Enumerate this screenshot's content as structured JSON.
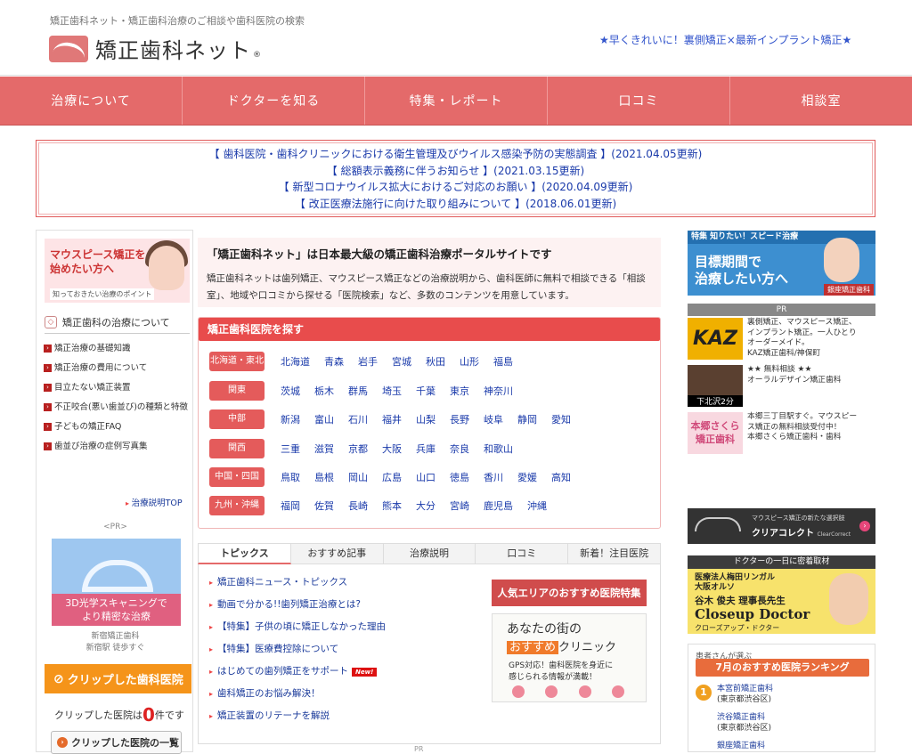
{
  "header": {
    "tagline": "矯正歯科ネット・矯正歯科治療のご相談や歯科医院の検索",
    "logo_text": "矯正歯科ネット",
    "logo_mark": "®",
    "promo": "★早くきれいに！裏側矯正×最新インプラント矯正★"
  },
  "nav": [
    "治療について",
    "ドクターを知る",
    "特集・レポート",
    "口コミ",
    "相談室"
  ],
  "notices": [
    "【 歯科医院・歯科クリニックにおける衛生管理及びウイルス感染予防の実態調査 】(2021.04.05更新)",
    "【 総額表示義務に伴うお知らせ 】(2021.03.15更新)",
    "【 新型コロナウイルス拡大におけるご対応のお願い 】(2020.04.09更新)",
    "【 改正医療法施行に向けた取り組みについて 】(2018.06.01更新)"
  ],
  "left": {
    "mp_banner": {
      "line1": "マウスピース矯正を",
      "line2": "始めたい方へ",
      "line3": "知っておきたい治療のポイント"
    },
    "guide_title": "矯正歯科の治療について",
    "guide_items": [
      "矯正治療の基礎知識",
      "矯正治療の費用について",
      "目立たない矯正装置",
      "不正咬合(悪い歯並び)の種類と特徴",
      "子どもの矯正FAQ",
      "歯並び治療の症例写真集"
    ],
    "guide_top": "治療説明TOP",
    "pr": "<PR>",
    "scan_caption1": "3D光学スキャニングで",
    "scan_caption2": "より精密な治療",
    "scan_clinic": "新宿矯正歯科",
    "scan_access": "新宿駅 徒歩すぐ",
    "clip_banner": "クリップした歯科医院",
    "clip_prefix": "クリップした医院は",
    "clip_count": "0",
    "clip_suffix": "件です",
    "clip_list": "クリップした医院の一覧"
  },
  "main": {
    "intro_title": "「矯正歯科ネット」は日本最大級の矯正歯科治療ポータルサイトです",
    "intro_text": "矯正歯科ネットは歯列矯正、マウスピース矯正などの治療説明から、歯科医師に無料で相談できる「相談室」、地域や口コミから探せる「医院検索」など、多数のコンテンツを用意しています。",
    "search_title": "矯正歯科医院を探す",
    "regions": [
      {
        "name": "北海道・東北",
        "prefs": [
          "北海道",
          "青森",
          "岩手",
          "宮城",
          "秋田",
          "山形",
          "福島"
        ]
      },
      {
        "name": "関東",
        "prefs": [
          "茨城",
          "栃木",
          "群馬",
          "埼玉",
          "千葉",
          "東京",
          "神奈川"
        ]
      },
      {
        "name": "中部",
        "prefs": [
          "新潟",
          "富山",
          "石川",
          "福井",
          "山梨",
          "長野",
          "岐阜",
          "静岡",
          "愛知"
        ]
      },
      {
        "name": "関西",
        "prefs": [
          "三重",
          "滋賀",
          "京都",
          "大阪",
          "兵庫",
          "奈良",
          "和歌山"
        ]
      },
      {
        "name": "中国・四国",
        "prefs": [
          "鳥取",
          "島根",
          "岡山",
          "広島",
          "山口",
          "徳島",
          "香川",
          "愛媛",
          "高知"
        ]
      },
      {
        "name": "九州・沖縄",
        "prefs": [
          "福岡",
          "佐賀",
          "長崎",
          "熊本",
          "大分",
          "宮崎",
          "鹿児島",
          "沖縄"
        ]
      }
    ],
    "tabs": [
      "トピックス",
      "おすすめ記事",
      "治療説明",
      "口コミ",
      "新着！注目医院"
    ],
    "topics": [
      "矯正歯科ニュース・トピックス",
      "動画で分かる!!歯列矯正治療とは?",
      "【特集】子供の頃に矯正しなかった理由",
      "【特集】医療費控除について",
      "はじめての歯列矯正をサポート",
      "歯科矯正のお悩み解決！",
      "矯正装置のリテーナを解説"
    ],
    "new_badge": "New!",
    "area_banner": "人気エリアのおすすめ医院特集",
    "town": {
      "line1": "あなたの街の",
      "hl": "おすすめ",
      "line2": "クリニック",
      "line3": "GPS対応！歯科医院を身近に",
      "line4": "感じられる情報が満載！"
    }
  },
  "right": {
    "speed": {
      "label": "特集 知りたい！スピード治療",
      "line1": "目標期間で",
      "line2": "治療したい方へ",
      "clinic": "銀座矯正歯科"
    },
    "pr": "PR",
    "ads": [
      {
        "img": "KAZ",
        "lines": [
          "裏側矯正、マウスピース矯正、",
          "インプラント矯正。一人ひとり",
          "オーダーメイド。",
          "KAZ矯正歯科/神保町"
        ]
      },
      {
        "img": "下北沢2分",
        "lines": [
          "★★ 無料相談 ★★",
          "オーラルデザイン矯正歯科"
        ]
      },
      {
        "img1": "本郷さくら",
        "img2": "矯正歯科",
        "lines": [
          "本郷三丁目駅すぐ。マウスピー",
          "ス矯正の無料相談受付中！",
          "本郷さくら矯正歯科・歯科"
        ]
      }
    ],
    "clear": {
      "small": "マウスピース矯正の新たな選択肢",
      "big": "クリアコレクト",
      "sub": "ClearCorrect"
    },
    "closeup": {
      "head": "ドクターの一日に密着取材",
      "l1": "医療法人梅田リンガル",
      "l2": "大阪オルソ",
      "name": "谷木 俊夫 理事長先生",
      "title": "Closeup Doctor",
      "sub": "クローズアップ・ドクター"
    },
    "rank": {
      "sub": "患者さんが選ぶ",
      "title": "7月のおすすめ医院ランキング",
      "medal": "1",
      "items": [
        {
          "name": "本宮前矯正歯科",
          "area": "(東京都渋谷区)"
        },
        {
          "name": "渋谷矯正歯科",
          "area": "(東京都渋谷区)"
        },
        {
          "name": "銀座矯正歯科",
          "area": ""
        }
      ]
    }
  },
  "bottom_pr": "PR",
  "colors": {
    "nav": "#e46a6a",
    "accent_red": "#e84c4c",
    "link": "#1a3a9a",
    "orange": "#f5941a"
  }
}
